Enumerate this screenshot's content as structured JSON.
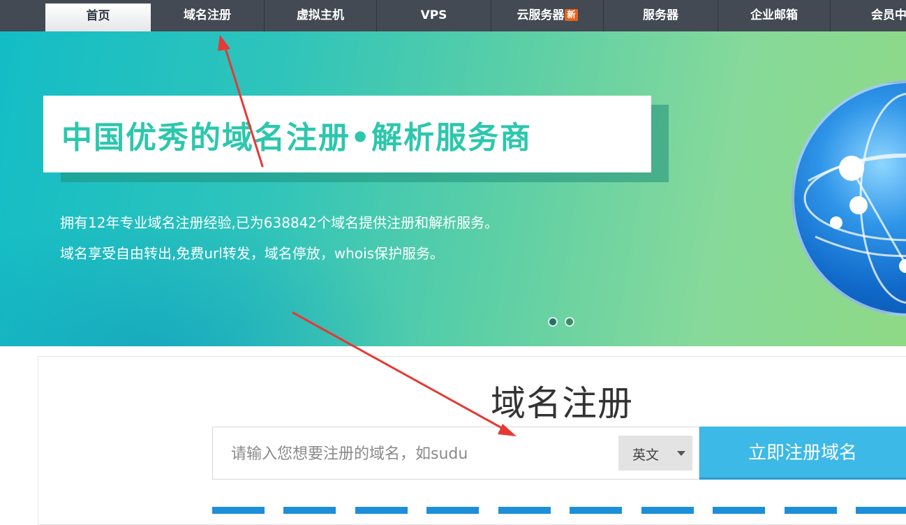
{
  "nav": {
    "items": [
      {
        "label": "首页",
        "active": true
      },
      {
        "label": "域名注册"
      },
      {
        "label": "虚拟主机"
      },
      {
        "label": "VPS"
      },
      {
        "label": "云服务器",
        "badge": "新"
      },
      {
        "label": "服务器"
      },
      {
        "label": "企业邮箱"
      },
      {
        "label": "会员中"
      }
    ]
  },
  "banner": {
    "slogan": "中国优秀的域名注册•解析服务商",
    "line1": "拥有12年专业域名注册经验,已为638842个域名提供注册和解析服务。",
    "line2": "域名享受自由转出,免费url转发，域名停放，whois保护服务。",
    "slide_count": 2,
    "icons": {
      "globe": "globe-network-icon"
    }
  },
  "domain_register": {
    "title": "域名注册",
    "search_placeholder": "请输入您想要注册的域名，如sudu",
    "language_selected": "英文",
    "submit_label": "立即注册域名"
  },
  "colors": {
    "nav_bg": "#434a54",
    "banner_teal": "#13bdc6",
    "banner_green": "#8ed986",
    "slogan_text": "#2cc7ad",
    "register_button": "#3cb9e6",
    "annotation_arrow": "#e53935",
    "badge_new": "#e8641c"
  }
}
